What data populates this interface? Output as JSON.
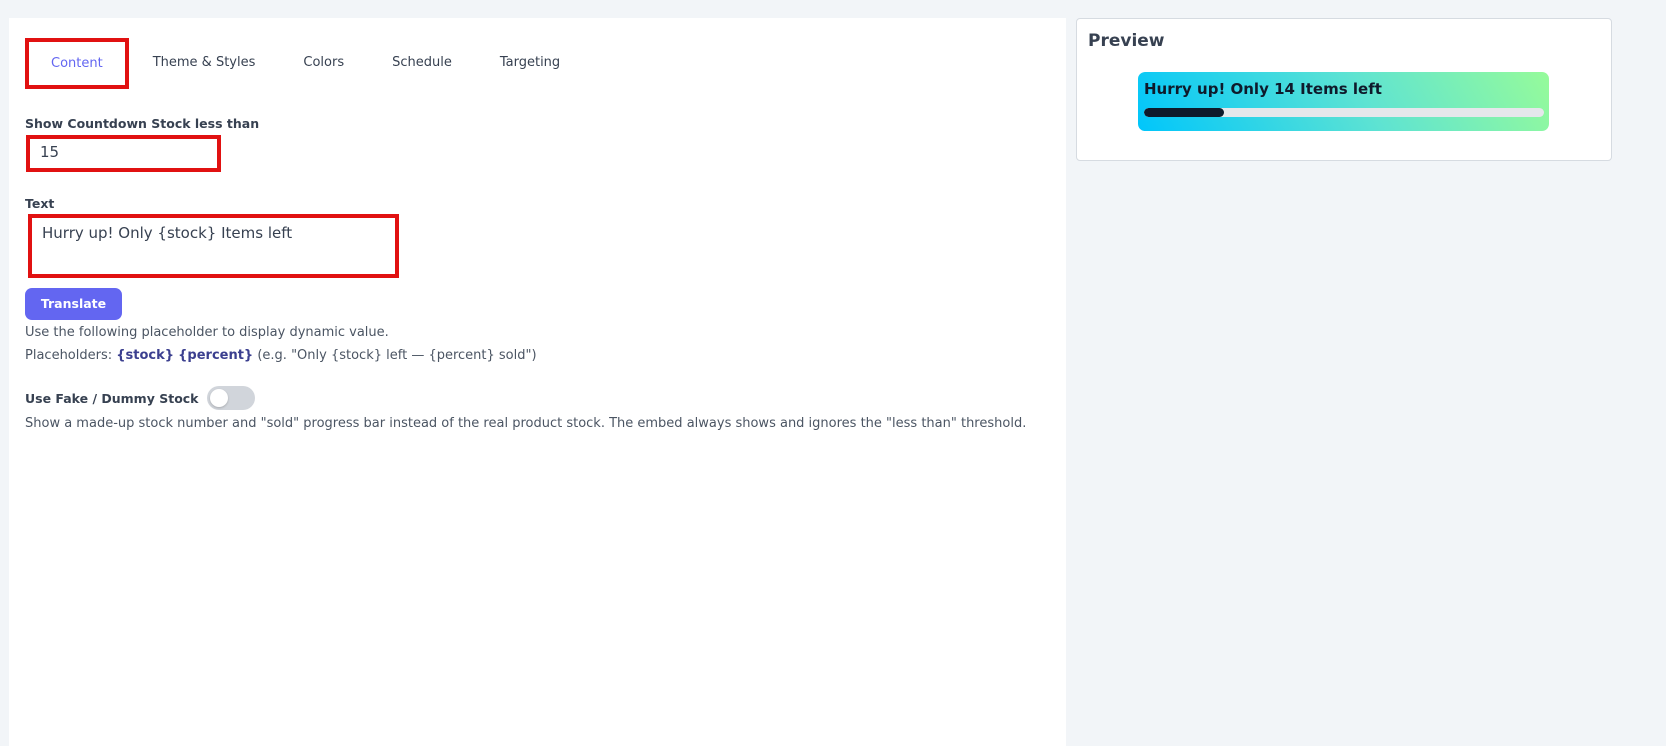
{
  "tabs": [
    {
      "label": "Content",
      "active": true
    },
    {
      "label": "Theme & Styles",
      "active": false
    },
    {
      "label": "Colors",
      "active": false
    },
    {
      "label": "Schedule",
      "active": false
    },
    {
      "label": "Targeting",
      "active": false
    }
  ],
  "content": {
    "stock_label": "Show Countdown Stock less than",
    "stock_value": "15",
    "text_label": "Text",
    "text_value": "Hurry up! Only {stock} Items left",
    "translate_button": "Translate",
    "helper_line": "Use the following placeholder to display dynamic value.",
    "placeholders_prefix": "Placeholders:",
    "placeholder_stock": "{stock}",
    "placeholder_percent": "{percent}",
    "placeholders_example": "(e.g. \"Only {stock} left — {percent} sold\")",
    "fake_stock_label": "Use Fake / Dummy Stock",
    "fake_stock_enabled": false,
    "fake_stock_description": "Show a made-up stock number and \"sold\" progress bar instead of the real product stock. The embed always shows and ignores the \"less than\" threshold."
  },
  "preview": {
    "title": "Preview",
    "banner_text": "Hurry up! Only 14 Items left",
    "progress_fraction": 0.2,
    "colors": {
      "gradient_start": "#00c6fb",
      "gradient_end": "#96fb9a",
      "bar_fill": "#0e1a2b",
      "bar_track": "#e5e7eb"
    }
  },
  "colors": {
    "accent": "#6366f1",
    "highlight_outline": "#e11111"
  }
}
